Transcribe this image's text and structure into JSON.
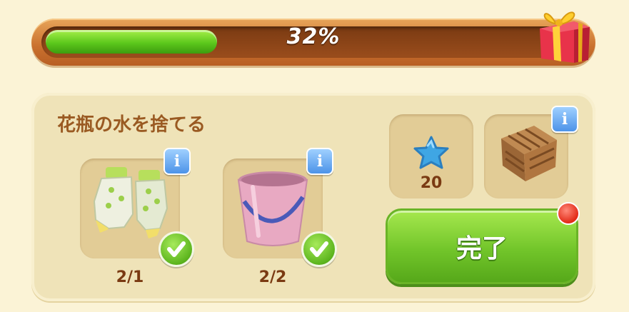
{
  "progress": {
    "percent_label": "32%",
    "value": 0.32
  },
  "task": {
    "title": "花瓶の水を捨てる",
    "requirements": [
      {
        "item": "gardening-gloves",
        "count": "2/1",
        "completed": true
      },
      {
        "item": "pink-bucket",
        "count": "2/2",
        "completed": true
      }
    ]
  },
  "rewards": [
    {
      "item": "blue-star",
      "amount": "20"
    },
    {
      "item": "wooden-crate",
      "amount": ""
    }
  ],
  "complete_button": {
    "label": "完了"
  },
  "colors": {
    "progress_fill": "#5cc81c",
    "button_green": "#72c52a",
    "title_brown": "#9a5a22",
    "count_brown": "#7a3a12",
    "info_blue": "#4c93e8",
    "notify_red": "#e22a17"
  },
  "icons": [
    "gift-icon",
    "info-icon",
    "check-icon",
    "star-icon",
    "gloves-icon",
    "bucket-icon",
    "crate-icon"
  ]
}
